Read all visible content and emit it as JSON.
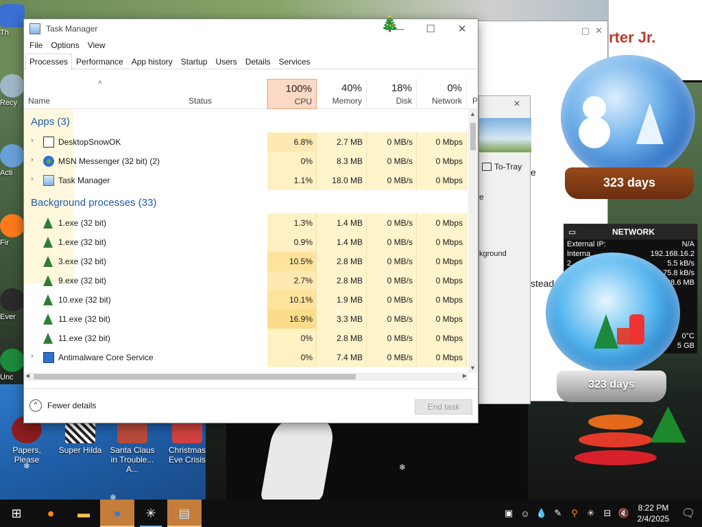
{
  "task_manager": {
    "title": "Task Manager",
    "menu": [
      "File",
      "Options",
      "View"
    ],
    "tabs": [
      "Processes",
      "Performance",
      "App history",
      "Startup",
      "Users",
      "Details",
      "Services"
    ],
    "active_tab": "Processes",
    "headers": {
      "name": "Name",
      "status": "Status",
      "cpu": {
        "pct": "100%",
        "label": "CPU"
      },
      "memory": {
        "pct": "40%",
        "label": "Memory"
      },
      "disk": {
        "pct": "18%",
        "label": "Disk"
      },
      "network": {
        "pct": "0%",
        "label": "Network"
      },
      "extra": "P"
    },
    "groups": {
      "apps": {
        "title": "Apps (3)",
        "rows": [
          {
            "name": "DesktopSnowOK",
            "cpu": "6.8%",
            "memory": "2.7 MB",
            "disk": "0 MB/s",
            "network": "0 Mbps",
            "icon": "snowflake-icon"
          },
          {
            "name": "MSN Messenger (32 bit) (2)",
            "cpu": "0%",
            "memory": "8.3 MB",
            "disk": "0 MB/s",
            "network": "0 Mbps",
            "icon": "messenger-icon"
          },
          {
            "name": "Task Manager",
            "cpu": "1.1%",
            "memory": "18.0 MB",
            "disk": "0 MB/s",
            "network": "0 Mbps",
            "icon": "taskmanager-icon"
          }
        ]
      },
      "background": {
        "title": "Background processes (33)",
        "rows": [
          {
            "name": "1.exe (32 bit)",
            "cpu": "1.3%",
            "memory": "1.4 MB",
            "disk": "0 MB/s",
            "network": "0 Mbps",
            "icon": "tree-icon"
          },
          {
            "name": "1.exe (32 bit)",
            "cpu": "0.9%",
            "memory": "1.4 MB",
            "disk": "0 MB/s",
            "network": "0 Mbps",
            "icon": "tree-icon"
          },
          {
            "name": "3.exe (32 bit)",
            "cpu": "10.5%",
            "memory": "2.8 MB",
            "disk": "0 MB/s",
            "network": "0 Mbps",
            "icon": "tree-icon"
          },
          {
            "name": "9.exe (32 bit)",
            "cpu": "2.7%",
            "memory": "2.8 MB",
            "disk": "0 MB/s",
            "network": "0 Mbps",
            "icon": "tree-icon"
          },
          {
            "name": "10.exe (32 bit)",
            "cpu": "10.1%",
            "memory": "1.9 MB",
            "disk": "0 MB/s",
            "network": "0 Mbps",
            "icon": "tree-icon"
          },
          {
            "name": "11.exe (32 bit)",
            "cpu": "16.9%",
            "memory": "3.3 MB",
            "disk": "0 MB/s",
            "network": "0 Mbps",
            "icon": "tree-icon"
          },
          {
            "name": "11.exe (32 bit)",
            "cpu": "0%",
            "memory": "2.8 MB",
            "disk": "0 MB/s",
            "network": "0 Mbps",
            "icon": "tree-icon"
          },
          {
            "name": "Antimalware Core Service",
            "cpu": "0%",
            "memory": "7.4 MB",
            "disk": "0 MB/s",
            "network": "0 Mbps",
            "icon": "service-icon"
          }
        ]
      }
    },
    "fewer_details": "Fewer details",
    "end_task": "End task"
  },
  "background_window": {
    "to_tray": "To-Tray",
    "fragment_1": "rter Jr.",
    "fragment_2": "e",
    "fragment_3": "e",
    "fragment_4": "kground",
    "fragment_5": "stead"
  },
  "desktop_icons": [
    {
      "label": "Papers, Please",
      "color": "#8b1d1d"
    },
    {
      "label": "Super Hilda",
      "color": "#d8d8d8"
    },
    {
      "label": "Santa Claus in Trouble... A...",
      "color": "#b84a3a"
    },
    {
      "label": "Christmas Eve Crisis",
      "color": "#d04040"
    }
  ],
  "left_icons": [
    "Th",
    "Recy",
    "Acti",
    "Fir",
    "Ever",
    "Unc"
  ],
  "gadgets": {
    "globe_top_days": "323 days",
    "globe_bottom_days": "323 days",
    "network": {
      "title": "NETWORK",
      "external_ip_label": "External IP:",
      "external_ip": "N/A",
      "internal_label": "Interna",
      "internal_ip": "192.168.16.2",
      "row3_label": "2",
      "row3_value": "5.5 kB/s",
      "row4_value": "75.8 kB/s",
      "row5_value": "28.6 MB",
      "temp": "0°C",
      "gb": "5 GB"
    }
  },
  "taskbar": {
    "time": "8:22 PM",
    "date": "2/4/2025"
  }
}
